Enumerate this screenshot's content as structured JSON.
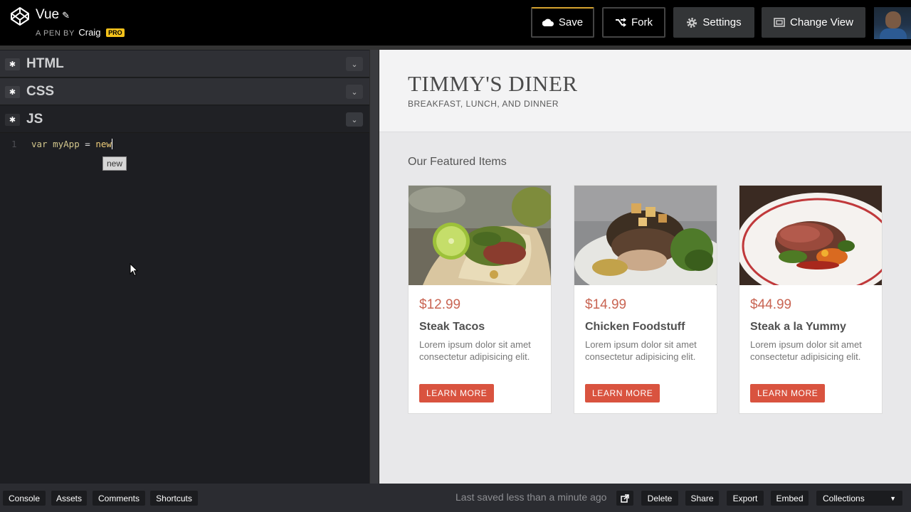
{
  "header": {
    "pen_title": "Vue",
    "pen_by_prefix": "A PEN BY",
    "author": "Craig",
    "badge": "PRO",
    "buttons": {
      "save": "Save",
      "fork": "Fork",
      "settings": "Settings",
      "change_view": "Change View"
    }
  },
  "editor": {
    "panels": [
      {
        "label": "HTML"
      },
      {
        "label": "CSS"
      },
      {
        "label": "JS"
      }
    ],
    "code": {
      "line_number": "1",
      "kw_var": "var",
      "identifier": "myApp",
      "operator": "=",
      "typed": "new"
    },
    "autocomplete": "new"
  },
  "preview": {
    "title": "TIMMY'S DINER",
    "subtitle": "BREAKFAST, LUNCH, AND DINNER",
    "section_title": "Our Featured Items",
    "cards": [
      {
        "price": "$12.99",
        "name": "Steak Tacos",
        "desc": "Lorem ipsum dolor sit amet consectetur adipisicing elit.",
        "button": "LEARN MORE"
      },
      {
        "price": "$14.99",
        "name": "Chicken Foodstuff",
        "desc": "Lorem ipsum dolor sit amet consectetur adipisicing elit.",
        "button": "LEARN MORE"
      },
      {
        "price": "$44.99",
        "name": "Steak a la Yummy",
        "desc": "Lorem ipsum dolor sit amet consectetur adipisicing elit.",
        "button": "LEARN MORE"
      }
    ]
  },
  "footer": {
    "left_buttons": [
      "Console",
      "Assets",
      "Comments",
      "Shortcuts"
    ],
    "saved_status": "Last saved less than a minute ago",
    "right_buttons": [
      "Delete",
      "Share",
      "Export",
      "Embed"
    ],
    "collections": "Collections"
  },
  "colors": {
    "accent_save_border": "#d6a32f",
    "pro_badge": "#f4c21b",
    "price": "#c96553",
    "learn_more": "#d9533f"
  },
  "icons": [
    "codepen-logo-icon",
    "pencil-icon",
    "cloud-icon",
    "fork-icon",
    "gear-icon",
    "change-view-icon",
    "chevron-down-icon",
    "external-link-icon",
    "mouse-cursor-icon"
  ]
}
